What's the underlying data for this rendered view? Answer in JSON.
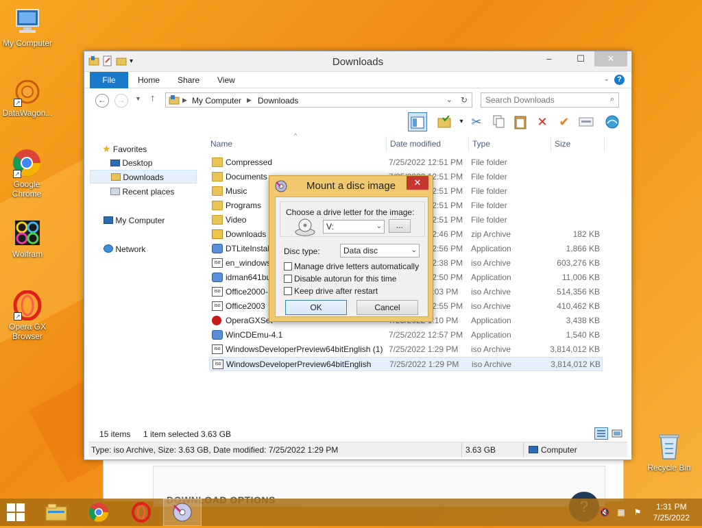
{
  "desktop": {
    "icons": [
      {
        "label": "My Computer"
      },
      {
        "label": "DataWagon..."
      },
      {
        "label": "Google Chrome"
      },
      {
        "label": "Wolfram"
      },
      {
        "label": "Opera GX Browser"
      },
      {
        "label": "Recycle Bin"
      }
    ],
    "background_page": {
      "heading": "DOWNLOAD OPTIONS",
      "help_glyph": "?"
    }
  },
  "window": {
    "title": "Downloads",
    "ribbon_tabs": [
      "File",
      "Home",
      "Share",
      "View"
    ],
    "address": {
      "root": "My Computer",
      "current": "Downloads"
    },
    "search_placeholder": "Search Downloads",
    "nav": {
      "favorites": "Favorites",
      "desktop": "Desktop",
      "downloads": "Downloads",
      "recent": "Recent places",
      "computer": "My Computer",
      "network": "Network"
    },
    "columns": {
      "name": "Name",
      "date": "Date modified",
      "type": "Type",
      "size": "Size"
    },
    "files": [
      {
        "name": "Compressed",
        "date": "7/25/2022 12:51 PM",
        "type": "File folder",
        "size": "",
        "icon": "folder"
      },
      {
        "name": "Documents",
        "date": "7/25/2022 12:51 PM",
        "type": "File folder",
        "size": "",
        "icon": "folder"
      },
      {
        "name": "Music",
        "date": "7/25/2022 12:51 PM",
        "type": "File folder",
        "size": "",
        "icon": "folder"
      },
      {
        "name": "Programs",
        "date": "7/25/2022 12:51 PM",
        "type": "File folder",
        "size": "",
        "icon": "folder"
      },
      {
        "name": "Video",
        "date": "7/25/2022 12:51 PM",
        "type": "File folder",
        "size": "",
        "icon": "folder"
      },
      {
        "name": "Downloads",
        "date": "7/25/2022 12:46 PM",
        "type": "zip Archive",
        "size": "182 KB",
        "icon": "zip"
      },
      {
        "name": "DTLiteInstal",
        "date": "7/25/2022 12:56 PM",
        "type": "Application",
        "size": "1,866 KB",
        "icon": "app"
      },
      {
        "name": "en_windows",
        "date": "7/25/2022 12:38 PM",
        "type": "iso Archive",
        "size": "603,276 KB",
        "icon": "iso"
      },
      {
        "name": "idman641bu",
        "date": "7/25/2022 12:50 PM",
        "type": "Application",
        "size": "11,006 KB",
        "icon": "app"
      },
      {
        "name": "Office2000-",
        "date": "7/25/2022 1:03 PM",
        "type": "iso Archive",
        "size": "514,356 KB",
        "icon": "iso"
      },
      {
        "name": "Office2003",
        "date": "7/25/2022 12:55 PM",
        "type": "iso Archive",
        "size": "410,462 KB",
        "icon": "iso"
      },
      {
        "name": "OperaGXSet",
        "date": "7/25/2022 1:10 PM",
        "type": "Application",
        "size": "3,438 KB",
        "icon": "opera"
      },
      {
        "name": "WinCDEmu-4.1",
        "date": "7/25/2022 12:57 PM",
        "type": "Application",
        "size": "1,540 KB",
        "icon": "app"
      },
      {
        "name": "WindowsDeveloperPreview64bitEnglish (1)",
        "date": "7/25/2022 1:29 PM",
        "type": "iso Archive",
        "size": "3,814,012 KB",
        "icon": "iso"
      },
      {
        "name": "WindowsDeveloperPreview64bitEnglish",
        "date": "7/25/2022 1:29 PM",
        "type": "iso Archive",
        "size": "3,814,012 KB",
        "icon": "iso",
        "selected": true
      }
    ],
    "status": {
      "items": "15 items",
      "selected": "1 item selected",
      "selected_size": "3.63 GB",
      "details": "Type: iso Archive, Size: 3.63 GB, Date modified: 7/25/2022 1:29 PM",
      "bar_size": "3.63 GB",
      "location": "Computer"
    }
  },
  "dialog": {
    "title": "Mount a disc image",
    "drive_label": "Choose a drive letter for the image:",
    "drive_value": "V:",
    "browse_label": "...",
    "disc_type_label": "Disc type:",
    "disc_type_value": "Data disc",
    "checkboxes": [
      {
        "label": "Manage drive letters automatically"
      },
      {
        "label": "Disable autorun for this time"
      },
      {
        "label": "Keep drive after restart"
      }
    ],
    "ok": "OK",
    "cancel": "Cancel"
  },
  "taskbar": {
    "time": "1:31 PM",
    "date": "7/25/2022"
  },
  "colors": {
    "accent": "#1979ca",
    "dialog_frame": "#f2c86e",
    "taskbar": "#aa6e14"
  }
}
